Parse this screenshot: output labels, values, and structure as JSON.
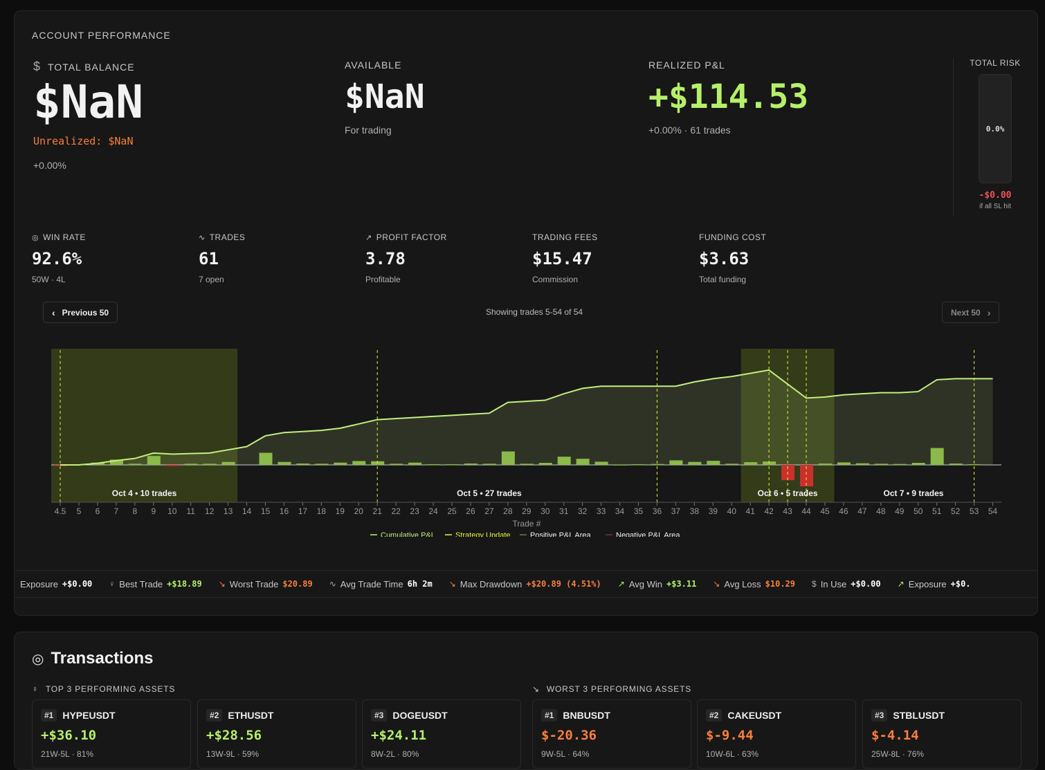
{
  "performance": {
    "section_title": "ACCOUNT PERFORMANCE",
    "total_balance": {
      "label": "TOTAL BALANCE",
      "value": "$NaN",
      "unrealized": "Unrealized: $NaN",
      "change": "+0.00%"
    },
    "available": {
      "label": "AVAILABLE",
      "value": "$NaN",
      "sub": "For trading"
    },
    "realized": {
      "label": "REALIZED P&L",
      "value": "+$114.53",
      "sub": "+0.00% · 61 trades"
    },
    "total_risk": {
      "label": "TOTAL RISK",
      "percent": "0.0%",
      "value": "-$0.00",
      "sub": "if all SL hit"
    }
  },
  "stats": [
    {
      "label": "WIN RATE",
      "icon": "target-icon",
      "value": "92.6%",
      "sub": "50W · 4L"
    },
    {
      "label": "TRADES",
      "icon": "activity-icon",
      "value": "61",
      "sub": "7 open"
    },
    {
      "label": "PROFIT FACTOR",
      "icon": "trending-up-icon",
      "value": "3.78",
      "sub": "Profitable"
    },
    {
      "label": "TRADING FEES",
      "value": "$15.47",
      "sub": "Commission"
    },
    {
      "label": "FUNDING COST",
      "value": "$3.63",
      "sub": "Total funding"
    }
  ],
  "pager": {
    "prev": "Previous 50",
    "next": "Next 50",
    "showing": "Showing trades 5-54 of 54"
  },
  "chart_data": {
    "type": "line",
    "xlabel": "Trade #",
    "x_ticks": [
      "4.5",
      "5",
      "6",
      "7",
      "8",
      "9",
      "10",
      "11",
      "12",
      "13",
      "14",
      "15",
      "16",
      "17",
      "18",
      "19",
      "20",
      "21",
      "22",
      "23",
      "24",
      "25",
      "26",
      "27",
      "28",
      "29",
      "30",
      "31",
      "32",
      "33",
      "34",
      "35",
      "36",
      "37",
      "38",
      "39",
      "40",
      "41",
      "42",
      "43",
      "44",
      "45",
      "46",
      "47",
      "48",
      "49",
      "50",
      "51",
      "52",
      "53",
      "54"
    ],
    "legend": [
      "Cumulative P&L",
      "Strategy Update",
      "Positive P&L Area",
      "Negative P&L Area"
    ],
    "series": [
      {
        "name": "Cumulative P&L",
        "x": [
          4.5,
          5,
          6,
          7,
          8,
          9,
          10,
          11,
          12,
          13,
          14,
          15,
          16,
          17,
          18,
          19,
          20,
          21,
          22,
          23,
          24,
          25,
          26,
          27,
          28,
          29,
          30,
          31,
          32,
          33,
          34,
          35,
          36,
          37,
          38,
          39,
          40,
          41,
          42,
          43,
          44,
          45,
          46,
          47,
          48,
          49,
          50,
          51,
          52,
          53,
          54
        ],
        "values": [
          0,
          0,
          1.5,
          4,
          6,
          11,
          10,
          10.5,
          11,
          14,
          17,
          27,
          30,
          31,
          32,
          34,
          38,
          42,
          43,
          44,
          45,
          46,
          47,
          48,
          58,
          59,
          60,
          66,
          71,
          73,
          73,
          73,
          73,
          73,
          77,
          80,
          82,
          85,
          88,
          75,
          62,
          63,
          65,
          66,
          67,
          67,
          68,
          79,
          80,
          80,
          80
        ]
      }
    ],
    "trade_pnl": [
      -0.5,
      0.3,
      1,
      2.3,
      0.5,
      3.9,
      -0.5,
      0.5,
      0.5,
      1.3,
      0,
      5.3,
      1.3,
      0.6,
      0.5,
      1,
      1.7,
      1.6,
      0.5,
      1,
      0.3,
      0.3,
      0.6,
      0.5,
      5.9,
      0.5,
      0.9,
      3.6,
      2.7,
      1.4,
      0.2,
      0.3,
      0.4,
      2,
      1.3,
      1.8,
      0.5,
      1.2,
      1.5,
      -6.7,
      -9.4,
      0.6,
      1.1,
      0.7,
      0.5,
      0.4,
      0.9,
      7.4,
      0.6,
      0.3,
      0.1
    ],
    "strategy_updates": [
      4.5,
      21,
      36,
      42,
      43,
      44,
      53
    ],
    "periods": [
      {
        "label": "Oct 4 • 10 trades",
        "from": 4.5,
        "to": 13.5,
        "highlight": true
      },
      {
        "label": "Oct 5 • 27 trades",
        "from": 13.5,
        "to": 40.5,
        "highlight": false
      },
      {
        "label": "Oct 6 • 5 trades",
        "from": 40.5,
        "to": 45.5,
        "highlight": true
      },
      {
        "label": "Oct 7 • 9 trades",
        "from": 45.5,
        "to": 54,
        "highlight": false
      }
    ]
  },
  "ticker": [
    {
      "label": "Exposure",
      "value": "+$0.00",
      "color": "#ffffff"
    },
    {
      "label": "Best Trade",
      "value": "+$18.89",
      "color": "#b6f06a",
      "icon": "award-icon"
    },
    {
      "label": "Worst Trade",
      "value": "$20.89",
      "color": "#f97f3c",
      "icon": "trending-down-icon"
    },
    {
      "label": "Avg Trade Time",
      "value": "6h 2m",
      "color": "#ffffff",
      "icon": "activity-icon"
    },
    {
      "label": "Max Drawdown",
      "value": "+$20.89 (4.51%)",
      "color": "#f97f3c",
      "icon": "trending-down-icon"
    },
    {
      "label": "Avg Win",
      "value": "+$3.11",
      "color": "#b6f06a",
      "icon": "trending-up-icon"
    },
    {
      "label": "Avg Loss",
      "value": "$10.29",
      "color": "#f97f3c",
      "icon": "trending-down-icon"
    },
    {
      "label": "In Use",
      "value": "+$0.00",
      "color": "#ffffff",
      "icon": "dollar-icon"
    },
    {
      "label": "Exposure",
      "value": "+$0.",
      "color": "#ffffff",
      "icon": "trending-up-icon"
    }
  ],
  "transactions": {
    "title": "Transactions",
    "top_label": "TOP 3 PERFORMING ASSETS",
    "worst_label": "WORST 3 PERFORMING ASSETS",
    "top": [
      {
        "rank": "#1",
        "symbol": "HYPEUSDT",
        "pnl": "+$36.10",
        "record": "21W-5L · 81%"
      },
      {
        "rank": "#2",
        "symbol": "ETHUSDT",
        "pnl": "+$28.56",
        "record": "13W-9L · 59%"
      },
      {
        "rank": "#3",
        "symbol": "DOGEUSDT",
        "pnl": "+$24.11",
        "record": "8W-2L · 80%"
      }
    ],
    "worst": [
      {
        "rank": "#1",
        "symbol": "BNBUSDT",
        "pnl": "$-20.36",
        "record": "9W-5L · 64%"
      },
      {
        "rank": "#2",
        "symbol": "CAKEUSDT",
        "pnl": "$-9.44",
        "record": "10W-6L · 63%"
      },
      {
        "rank": "#3",
        "symbol": "STBLUSDT",
        "pnl": "$-4.14",
        "record": "25W-8L · 76%"
      }
    ]
  }
}
